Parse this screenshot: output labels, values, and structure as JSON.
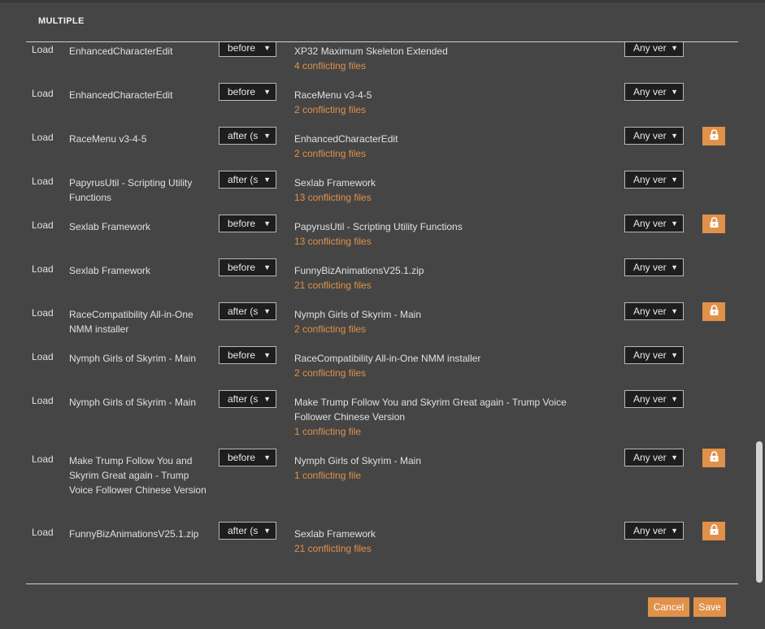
{
  "dialog": {
    "title": "MULTIPLE",
    "cancel_label": "Cancel",
    "save_label": "Save"
  },
  "colors": {
    "background": "#454545",
    "accent": "#e0914a",
    "dropdown_bg": "#1e1e1e",
    "text": "#e0e0e0"
  },
  "rules": [
    {
      "load": "Load",
      "source": "EnhancedCharacterEdit",
      "relation": "before",
      "target": "XP32 Maximum Skeleton Extended",
      "conflicts": "4 conflicting files",
      "version": "Any version",
      "locked": false
    },
    {
      "load": "Load",
      "source": "EnhancedCharacterEdit",
      "relation": "before",
      "target": "RaceMenu v3-4-5",
      "conflicts": "2 conflicting files",
      "version": "Any version",
      "locked": false
    },
    {
      "load": "Load",
      "source": "RaceMenu v3-4-5",
      "relation": "after (s",
      "target": "EnhancedCharacterEdit",
      "conflicts": "2 conflicting files",
      "version": "Any version",
      "locked": true
    },
    {
      "load": "Load",
      "source": "PapyrusUtil - Scripting Utility Functions",
      "relation": "after (s",
      "target": "Sexlab Framework",
      "conflicts": "13 conflicting files",
      "version": "Any version",
      "locked": false
    },
    {
      "load": "Load",
      "source": "Sexlab Framework",
      "relation": "before",
      "target": "PapyrusUtil - Scripting Utility Functions",
      "conflicts": "13 conflicting files",
      "version": "Any version",
      "locked": true
    },
    {
      "load": "Load",
      "source": "Sexlab Framework",
      "relation": "before",
      "target": "FunnyBizAnimationsV25.1.zip",
      "conflicts": "21 conflicting files",
      "version": "Any version",
      "locked": false
    },
    {
      "load": "Load",
      "source": "RaceCompatibility All-in-One NMM installer",
      "relation": "after (s",
      "target": "Nymph Girls of Skyrim - Main",
      "conflicts": "2 conflicting files",
      "version": "Any version",
      "locked": true
    },
    {
      "load": "Load",
      "source": "Nymph Girls of Skyrim - Main",
      "relation": "before",
      "target": "RaceCompatibility All-in-One NMM installer",
      "conflicts": "2 conflicting files",
      "version": "Any version",
      "locked": false
    },
    {
      "load": "Load",
      "source": "Nymph Girls of Skyrim - Main",
      "relation": "after (s",
      "target": "Make Trump Follow You and Skyrim Great again - Trump Voice Follower Chinese Version",
      "conflicts": "1 conflicting file",
      "version": "Any version",
      "locked": false
    },
    {
      "load": "Load",
      "source": "Make Trump Follow You and Skyrim Great again - Trump Voice Follower Chinese Version",
      "relation": "before",
      "target": "Nymph Girls of Skyrim - Main",
      "conflicts": "1 conflicting file",
      "version": "Any version",
      "locked": true
    },
    {
      "load": "Load",
      "source": "FunnyBizAnimationsV25.1.zip",
      "relation": "after (s",
      "target": "Sexlab Framework",
      "conflicts": "21 conflicting files",
      "version": "Any version",
      "locked": true
    }
  ],
  "icons": {
    "lock": "lock-icon",
    "dropdown": "caret-down-icon"
  }
}
